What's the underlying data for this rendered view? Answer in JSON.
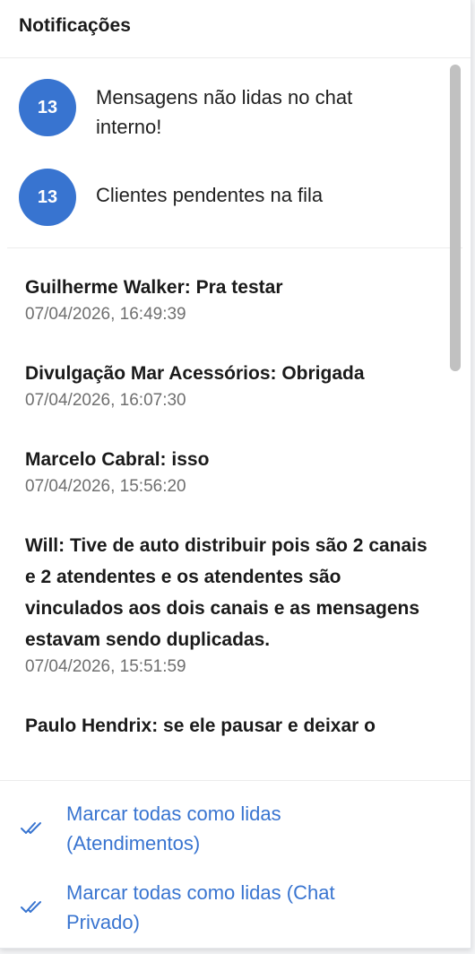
{
  "header": {
    "title": "Notificações"
  },
  "summary": [
    {
      "count": "13",
      "text": "Mensagens não lidas no chat interno!"
    },
    {
      "count": "13",
      "text": "Clientes pendentes na fila"
    }
  ],
  "messages": [
    {
      "title": "Guilherme Walker: Pra testar",
      "time": "07/04/2026, 16:49:39"
    },
    {
      "title": "Divulgação Mar Acessórios: Obrigada",
      "time": "07/04/2026, 16:07:30"
    },
    {
      "title": "Marcelo Cabral: isso",
      "time": "07/04/2026, 15:56:20"
    },
    {
      "title": "Will: Tive de auto distribuir pois são 2 canais e 2 atendentes e os atendentes são vinculados aos dois canais e as mensagens estavam sendo duplicadas.",
      "time": "07/04/2026, 15:51:59"
    },
    {
      "title": "Paulo Hendrix: se ele pausar e deixar o",
      "time": ""
    }
  ],
  "footer": {
    "mark_all_attendances": "Marcar todas como lidas (Atendimentos)",
    "mark_all_private_chat": "Marcar todas como lidas (Chat Privado)"
  },
  "colors": {
    "accent": "#3874d0",
    "circle": "#3874d0"
  },
  "icons": {
    "action_icon": "double-check-icon"
  }
}
